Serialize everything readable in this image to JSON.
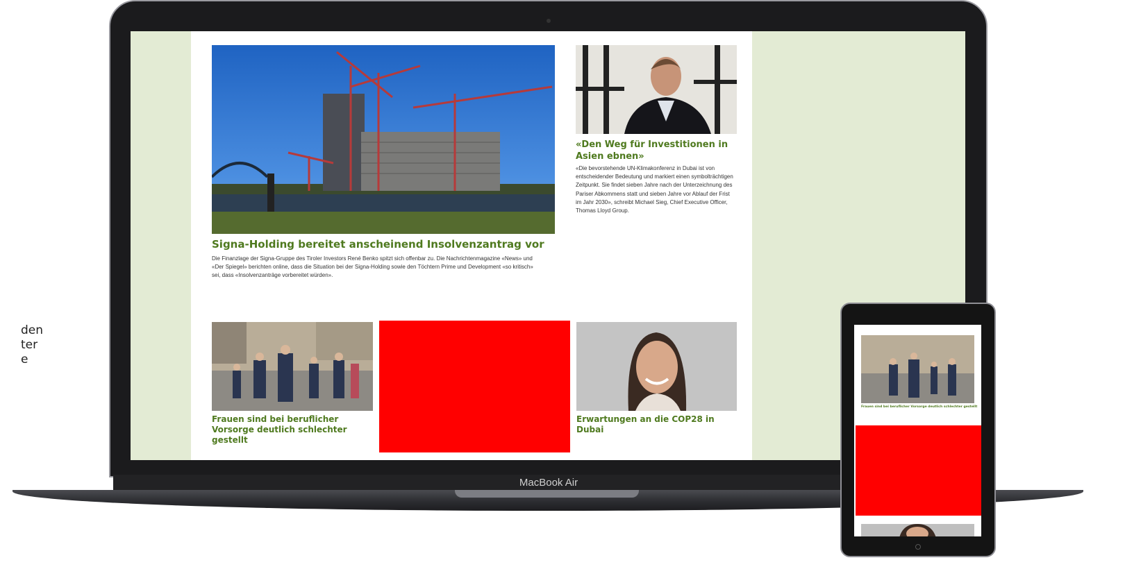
{
  "left_fragment": [
    "den",
    "ter",
    "e"
  ],
  "laptop": {
    "label": "MacBook Air"
  },
  "article_main": {
    "title": "Signa-Holding bereitet anscheinend Insolvenzantrag vor",
    "text": "Die Finanzlage der Signa-Gruppe des Tiroler Investors René Benko spitzt sich offenbar zu. Die Nachrichtenmagazine «News» und «Der Spiegel» berichten online, dass die Situation bei der Signa-Holding sowie den Töchtern Prime und Development «so kritisch» sei, dass «Insolvenzanträge vorbereitet würden»."
  },
  "article_side": {
    "title": "«Den Weg für Investitionen in Asien ebnen»",
    "text": "«Die bevorstehende UN-Klimakonferenz in Dubai ist von entscheidender Bedeutung und markiert einen symbolträchtigen Zeitpunkt. Sie findet sieben Jahre nach der Unterzeichnung des Pariser Abkommens statt und sieben Jahre vor Ablauf der Frist im Jahr 2030», schreibt Michael Sieg, Chief Executive Officer, Thomas Lloyd Group."
  },
  "cards": [
    {
      "title": "Frauen sind bei beruflicher Vorsorge deutlich schlechter gestellt"
    },
    {
      "title": "Erwartungen an die COP28 in Dubai"
    }
  ],
  "tablet": {
    "title": "Frauen sind bei beruflicher Vorsorge deutlich schlechter gestellt"
  },
  "colors": {
    "accent_green": "#4f7a1f",
    "screen_bg": "#e3ebd4",
    "ad_red": "#ff0000"
  }
}
